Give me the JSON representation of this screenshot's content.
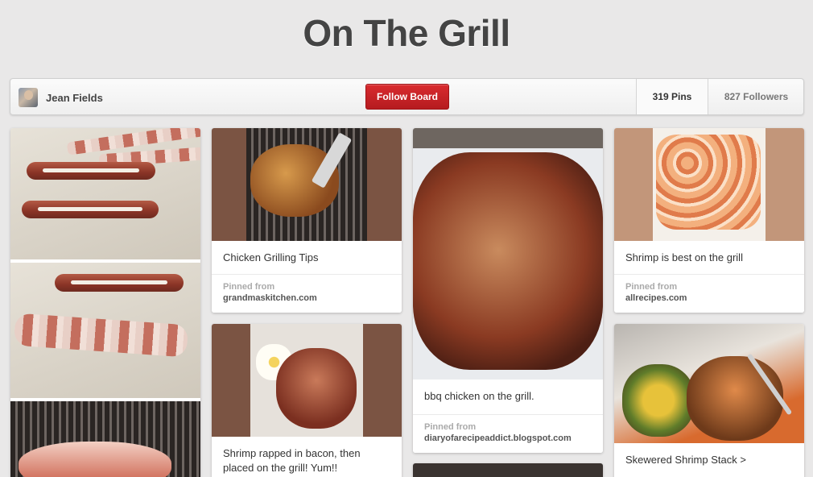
{
  "board": {
    "title": "On The Grill",
    "owner_name": "Jean Fields",
    "follow_label": "Follow Board",
    "pins_count": "319 Pins",
    "followers_count": "827 Followers"
  },
  "pins": [
    {
      "description": "Chicken Grilling Tips",
      "source_label": "Pinned from",
      "source_domain": "grandmaskitchen.com"
    },
    {
      "description": "Shrimp rapped in bacon, then placed on the grill! Yum!!"
    },
    {
      "description": "bbq chicken on the grill.",
      "source_label": "Pinned from",
      "source_domain": "diaryofarecipeaddict.blogspot.com"
    },
    {
      "description": "Shrimp is best on the grill",
      "source_label": "Pinned from",
      "source_domain": "allrecipes.com"
    },
    {
      "description": "Skewered Shrimp Stack >"
    }
  ],
  "colors": {
    "follow_button": "#c9222b",
    "image_frame_brown": "#7b5443",
    "image_frame_tan": "#c2967a"
  }
}
